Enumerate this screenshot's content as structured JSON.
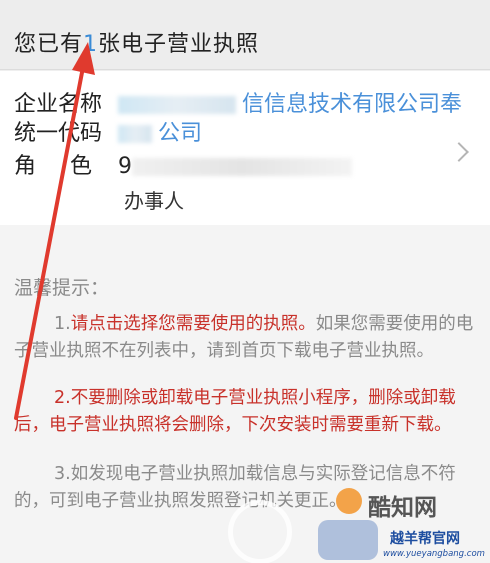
{
  "header": {
    "prefix": "您已有",
    "count": "1",
    "suffix": "张电子营业执照"
  },
  "card": {
    "company_label": "企业名称",
    "company_value": "信信息技术有限公司奉",
    "code_label": "统一代码",
    "code_value": "公司",
    "role_label": "角色",
    "role_value_visible": "9",
    "role_type": "办事人"
  },
  "tips": {
    "title": "温馨提示：",
    "p1_number": "1.",
    "p1_emphasis": "请点击选择您需要使用的执照。",
    "p1_rest": "如果您需要使用的电子营业执照不在列表中，请到首页下载电子营业执照。",
    "p2": "2.不要删除或卸载电子营业执照小程序，删除或卸载后，电子营业执照将会删除，下次安装时需要重新下载。",
    "p3": "3.如发现电子营业执照加载信息与实际登记信息不符的，可到电子营业执照发照登记机关更正。"
  },
  "watermark": {
    "brand": "酷知网",
    "site": "越羊帮官网",
    "url": "www.yueyangbang.com"
  },
  "colors": {
    "link_blue": "#4a90d9",
    "emphasis_red": "#c8312a",
    "arrow_red": "#e03a2e"
  },
  "icons": {
    "row_chevron": "chevron-right-icon",
    "annotation": "red-arrow"
  }
}
